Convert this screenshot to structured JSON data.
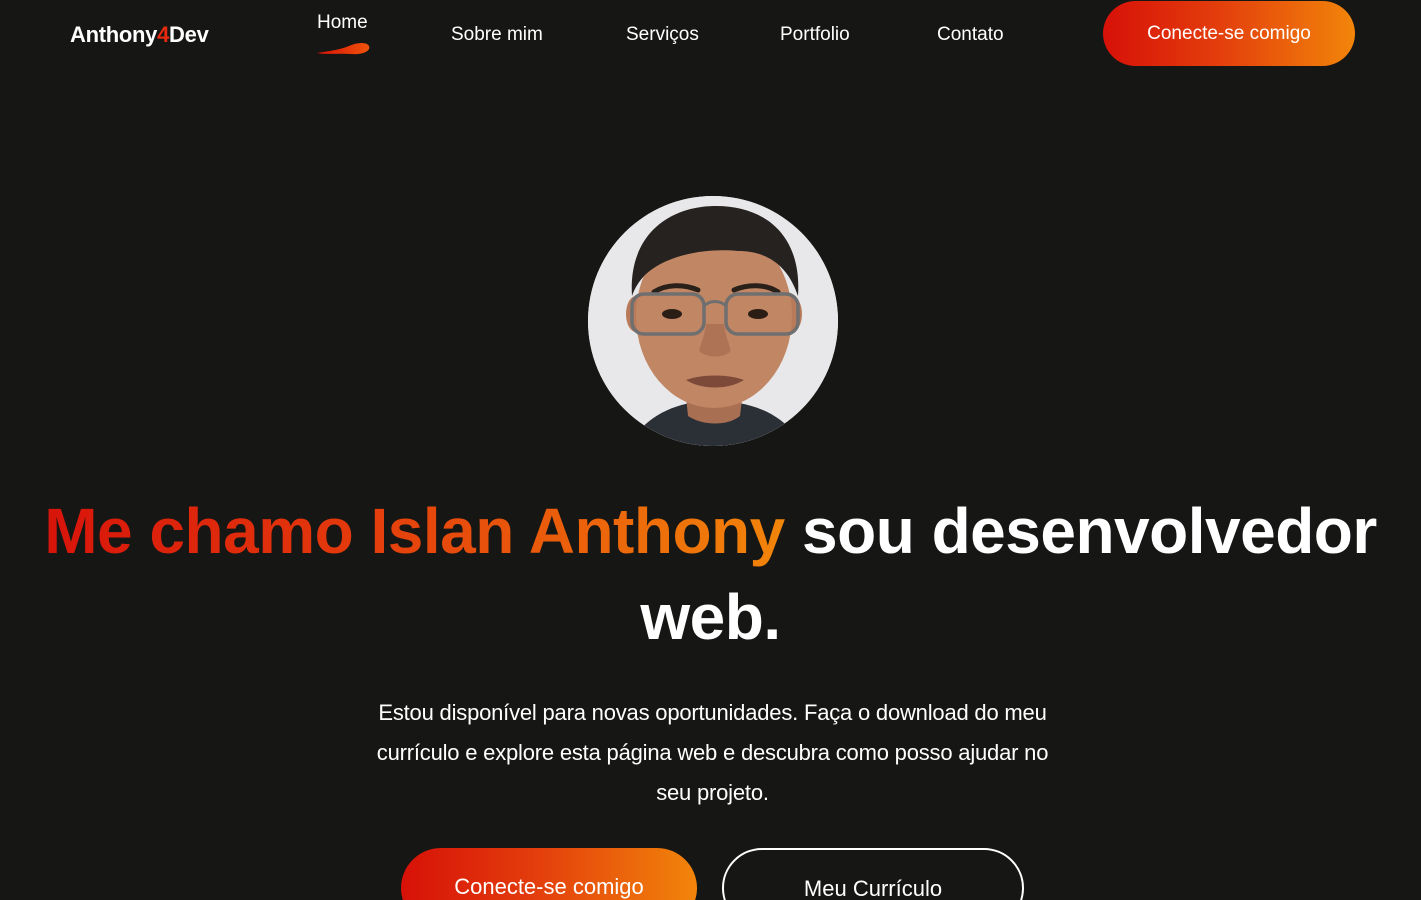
{
  "brand": {
    "name_prefix": "Anthony",
    "name_accent": "4",
    "name_suffix": "Dev"
  },
  "nav": {
    "items": [
      {
        "label": "Home",
        "active": true
      },
      {
        "label": "Sobre mim"
      },
      {
        "label": "Serviços"
      },
      {
        "label": "Portfolio"
      },
      {
        "label": "Contato"
      }
    ],
    "cta_label": "Conecte-se comigo"
  },
  "hero": {
    "headline_highlight": "Me chamo Islan Anthony",
    "headline_rest": " sou desenvolvedor web.",
    "description": "Estou disponível para novas oportunidades. Faça o download do meu currículo e explore esta página web e descubra como posso ajudar no seu projeto.",
    "primary_button": "Conecte-se comigo",
    "secondary_button": "Meu Currículo"
  },
  "colors": {
    "background": "#161614",
    "accent_red": "#d71108",
    "accent_orange": "#f2850a",
    "text": "#ffffff"
  },
  "icons": {
    "avatar": "profile-photo",
    "active_indicator": "brush-stroke-icon"
  }
}
